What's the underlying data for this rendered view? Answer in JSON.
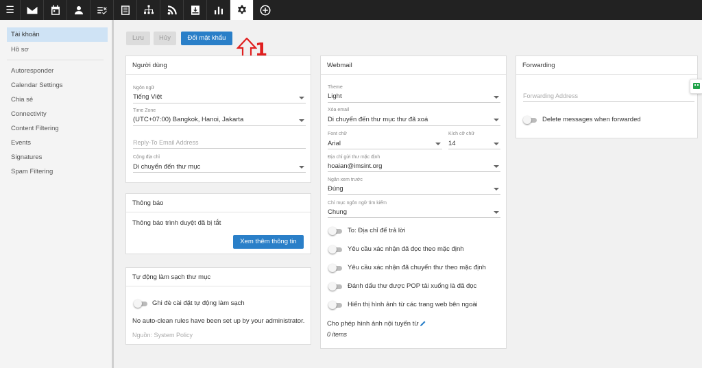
{
  "topbar": {
    "icons": [
      "menu-icon",
      "mail-icon",
      "calendar-icon",
      "contacts-icon",
      "tasks-icon",
      "notes-icon",
      "org-chart-icon",
      "rss-icon",
      "archive-icon",
      "reports-icon",
      "settings-icon",
      "add-circle-icon"
    ],
    "active": "settings-icon"
  },
  "sidebar": {
    "items": [
      {
        "label": "Tài khoản",
        "selected": true
      },
      {
        "label": "Hồ sơ"
      },
      {
        "label": "Autoresponder"
      },
      {
        "label": "Calendar Settings"
      },
      {
        "label": "Chia sẻ"
      },
      {
        "label": "Connectivity"
      },
      {
        "label": "Content Filtering"
      },
      {
        "label": "Events"
      },
      {
        "label": "Signatures"
      },
      {
        "label": "Spam Filtering"
      }
    ]
  },
  "toolbar": {
    "save_label": "Lưu",
    "cancel_label": "Hủy",
    "change_password_label": "Đổi mật khẩu"
  },
  "annotation": {
    "number": "1",
    "color": "#e02020"
  },
  "user_panel": {
    "title": "Người dùng",
    "language_label": "Ngôn ngữ",
    "language_value": "Tiếng Việt",
    "timezone_label": "Time Zone",
    "timezone_value": "(UTC+07:00) Bangkok, Hanoi, Jakarta",
    "replyto_placeholder": "Reply-To Email Address",
    "trash_label": "Cộng địa chỉ",
    "trash_value": "Di chuyển đến thư mục"
  },
  "notify_panel": {
    "title": "Thông báo",
    "text": "Thông báo trình duyệt đã bị tắt",
    "button_label": "Xem thêm thông tin"
  },
  "autoclean_panel": {
    "title": "Tự động làm sạch thư mục",
    "toggle_label": "Ghi đè cài đặt tự động làm sạch",
    "info": "No auto-clean rules have been set up by your administrator.",
    "source": "Nguồn: System Policy"
  },
  "webmail_panel": {
    "title": "Webmail",
    "theme_label": "Theme",
    "theme_value": "Light",
    "delete_label": "Xóa email",
    "delete_value": "Di chuyển đến thư mục thư đã xoá",
    "font_label": "Font chữ",
    "font_value": "Arial",
    "size_label": "Kích cỡ chữ",
    "size_value": "14",
    "from_label": "Địa chỉ gửi thư mặc định",
    "from_value": "hoaian@imsint.org",
    "preview_label": "Ngăn xem trước",
    "preview_value": "Đúng",
    "search_label": "Chỉ mục ngôn ngữ tìm kiếm",
    "search_value": "Chung",
    "toggles": [
      "To: Địa chỉ để trả lời",
      "Yêu cầu xác nhận đã đọc theo mặc định",
      "Yêu cầu xác nhận đã chuyển thư theo mặc định",
      "Đánh dấu thư được POP tải xuống là đã đọc",
      "Hiển thị hình ảnh từ các trang web bên ngoài"
    ],
    "inline_images_label": "Cho phép hình ảnh nội tuyến từ",
    "inline_images_count": "0 items"
  },
  "forwarding_panel": {
    "title": "Forwarding",
    "address_placeholder": "Forwarding Address",
    "delete_toggle_label": "Delete messages when forwarded"
  },
  "colors": {
    "primary": "#2a7fc8",
    "topbar": "#222222",
    "selected": "#cfe3f5",
    "badge": "#21a34a"
  }
}
